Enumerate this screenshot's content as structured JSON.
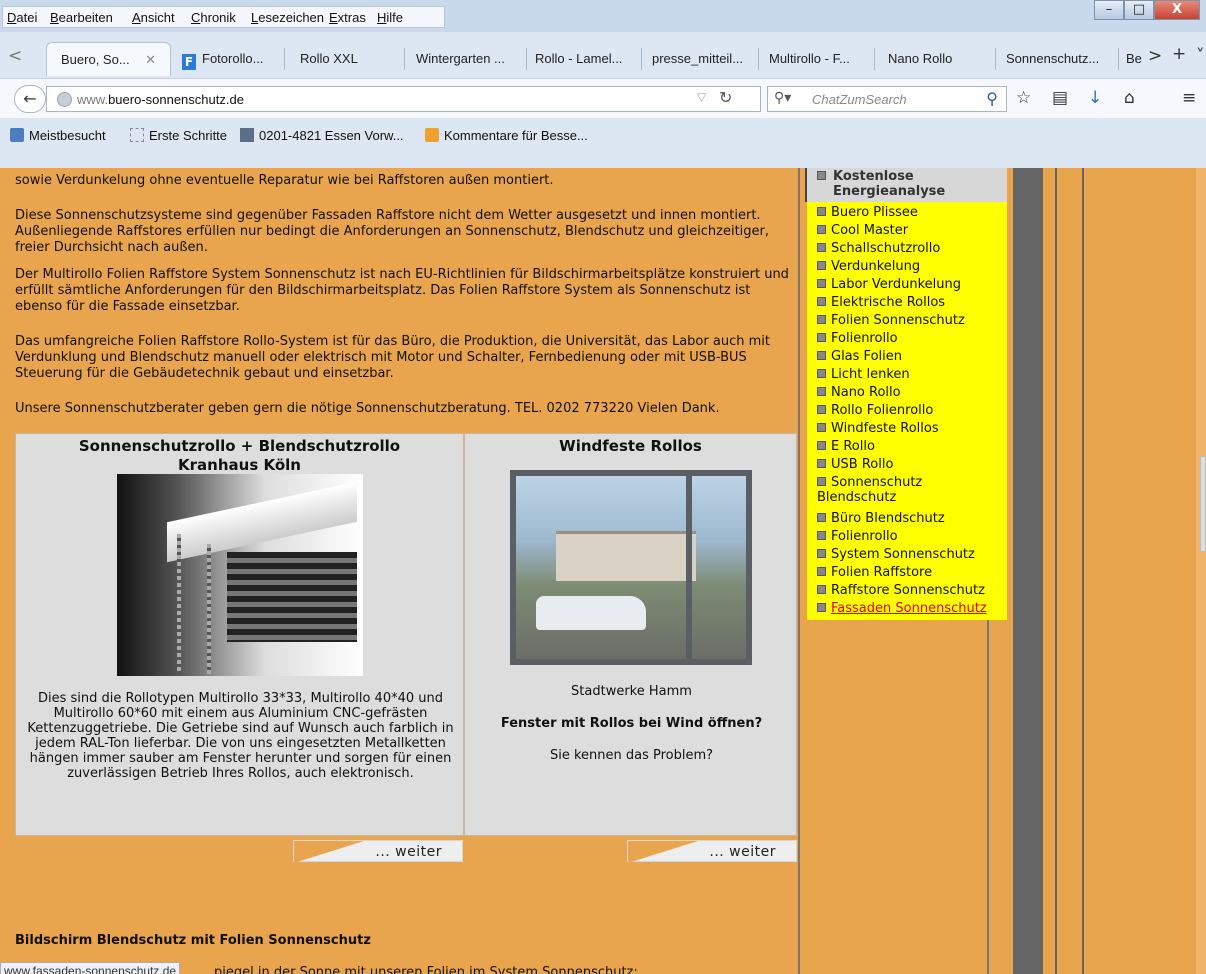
{
  "menu": {
    "items": [
      "Datei",
      "Bearbeiten",
      "Ansicht",
      "Chronik",
      "Lesezeichen",
      "Extras",
      "Hilfe"
    ]
  },
  "window": {
    "minimize": "–",
    "maximize": "□",
    "close": "X"
  },
  "tabs": [
    {
      "label": "Buero, So...",
      "selected": true
    },
    {
      "label": "Fotorollo...",
      "selected": false
    },
    {
      "label": "Rollo XXL",
      "selected": false
    },
    {
      "label": "Wintergarten ...",
      "selected": false
    },
    {
      "label": "Rollo - Lamel...",
      "selected": false
    },
    {
      "label": "presse_mitteil...",
      "selected": false
    },
    {
      "label": "Multirollo - F...",
      "selected": false
    },
    {
      "label": "Nano Rollo",
      "selected": false
    },
    {
      "label": "Sonnenschutz...",
      "selected": false
    },
    {
      "label": "Be",
      "selected": false
    }
  ],
  "tab_controls": {
    "scroll_left": "<",
    "close_tab": "✕",
    "scroll_right": ">",
    "new_tab": "+",
    "list": "˅"
  },
  "nav": {
    "url_prefix": "www.",
    "url_domain": "buero-sonnenschutz.de",
    "search_placeholder": "ChatZumSearch"
  },
  "bookmarks": [
    "Meistbesucht",
    "Erste Schritte",
    "0201-4821 Essen Vorw...",
    "Kommentare für Besse..."
  ],
  "content": {
    "p1": "sowie Verdunkelung ohne eventuelle Reparatur wie bei Raffstoren außen montiert.",
    "p2": "Diese Sonnenschutzsysteme sind gegenüber Fassaden Raffstore nicht dem Wetter ausgesetzt und innen montiert. Außenliegende Raffstores erfüllen nur bedingt die Anforderungen an Sonnenschutz, Blendschutz und gleichzeitiger, freier Durchsicht nach außen.",
    "p3": "Der Multirollo Folien Raffstore System Sonnenschutz ist nach EU-Richtlinien für Bildschirmarbeitsplätze konstruiert und erfüllt sämtliche Anforderungen für den Bildschirmarbeitsplatz. Das Folien Raffstore System als Sonnenschutz ist ebenso für die Fassade einsetzbar.",
    "p4": "Das umfangreiche Folien Raffstore Rollo-System ist für das Büro, die Produktion, die Universität, das Labor auch mit Verdunklung und Blendschutz manuell oder elektrisch mit Motor und Schalter, Fernbedienung oder mit USB-BUS Steuerung für die Gebäudetechnik gebaut und einsetzbar.",
    "p5": "Unsere Sonnenschutzberater geben gern die nötige Sonnenschutzberatung. TEL. 0202 773220 Vielen Dank.",
    "box1_title": "Sonnenschutzrollo + Blendschutzrollo Kranhaus Köln",
    "box1_text": "Dies sind die Rollotypen Multirollo 33*33, Multirollo 40*40 und Multirollo 60*60 mit einem aus Aluminium CNC-gefrästen Kettenzuggetriebe. Die Getriebe sind auf Wunsch auch farblich in jedem RAL-Ton lieferbar. Die von uns eingesetzten Metallketten hängen immer sauber am Fenster herunter und sorgen für einen zuverlässigen Betrieb Ihres Rollos, auch elektronisch.",
    "box2_title": "Windfeste Rollos",
    "box2_caption": "Stadtwerke Hamm",
    "box2_question": "Fenster mit Rollos bei Wind öffnen?",
    "box2_text": "Sie kennen das Problem?",
    "weiter": "... weiter",
    "section_heading": "Bildschirm Blendschutz mit Folien Sonnenschutz",
    "cut_line": "piegel in der Sonne mit unseren Folien im System Sonnenschutz:"
  },
  "sidebar": {
    "head": "Kostenlose Energieanalyse",
    "items": [
      "Buero Plissee",
      "Cool Master",
      "Schallschutzrollo",
      "Verdunkelung",
      "Labor Verdunkelung",
      "Elektrische Rollos",
      "Folien Sonnenschutz",
      "Folienrollo",
      "Glas Folien",
      "Licht lenken",
      "Nano Rollo",
      "Rollo Folienrollo",
      "Windfeste Rollos",
      "E Rollo",
      "USB Rollo",
      "Sonnenschutz Blendschutz",
      "Büro Blendschutz",
      "Folienrollo",
      "System Sonnenschutz",
      "Folien Raffstore",
      "Raffstore Sonnenschutz",
      "Fassaden Sonnenschutz"
    ],
    "active": "Fassaden Sonnenschutz"
  },
  "status": {
    "link": "www.fassaden-sonnenschutz.de"
  }
}
